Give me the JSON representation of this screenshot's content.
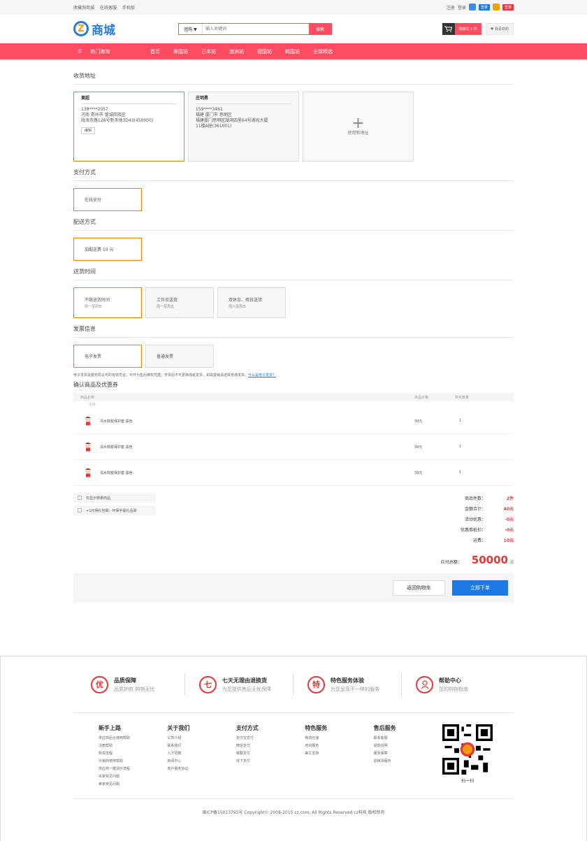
{
  "topbar": {
    "links": [
      "收藏淘商城",
      "在线客服",
      "手机版"
    ],
    "register": "注册",
    "login": "登录",
    "badge1": "登录",
    "badge2": "登录"
  },
  "header": {
    "logo_letter": "Z",
    "logo_text": "商城",
    "search_type": "团购 ▼",
    "search_placeholder": "输入关键词",
    "search_button": "搜索",
    "cart_label": "购物车 1 件",
    "fav_label": "♥ 我喜欢的"
  },
  "nav": {
    "category_label": "热门海淘",
    "items": [
      "首页",
      "美国站",
      "日本站",
      "澳洲站",
      "德国站",
      "韩国站",
      "全球精选"
    ]
  },
  "address": {
    "title": "收货地址",
    "cards": [
      {
        "name": "黄超",
        "phone": "139****2057",
        "line1": "河南 郑州市 管城回族区",
        "line2": "陇海东路126号新天地3D43(450000)",
        "line3": "",
        "edit": "编辑"
      },
      {
        "name": "庄明勇",
        "phone": "159****3461",
        "line1": "福建 厦门市 思明区",
        "line2": "福建厦门思明区湖滨四里64号湖光大厦",
        "line3": "11楼A座(361001)",
        "edit": ""
      }
    ],
    "add_label": "使用新地址"
  },
  "payment": {
    "title": "支付方式",
    "option": "在线支付"
  },
  "delivery": {
    "title": "配送方式",
    "option": "加配送费 10 元"
  },
  "delivery_time": {
    "title": "送货时间",
    "options": [
      {
        "label": "不限送货时间",
        "sub": "周一至周日"
      },
      {
        "label": "工作日送货",
        "sub": "周一至周五"
      },
      {
        "label": "双休日、假日送货",
        "sub": "周六至周日"
      }
    ]
  },
  "invoice": {
    "title": "发票信息",
    "options": [
      "电子发票",
      "普通发票"
    ],
    "note": "电子发票是税务局认可的有效凭证，可作为售后维权凭据，开票后不可更换成纸发票，如需报销请选择普通发票。",
    "note_link": "什么是电子发票？"
  },
  "confirm": {
    "title": "确认商品及优惠券",
    "col_name": "商品名称",
    "col_price": "单品价格",
    "col_qty": "购买数量",
    "subtotal_label": "小计",
    "items": [
      {
        "name": "渴水软胶保护套 黑色",
        "price": "39元",
        "qty": "1"
      },
      {
        "name": "渴水软胶保护套 黑色",
        "price": "39元",
        "qty": "1"
      },
      {
        "name": "渴水软胶保护套 黑色",
        "price": "39元",
        "qty": "1"
      }
    ],
    "check1": "仅显示特惠商品",
    "check2": "+1元得礼包袋：环保手提礼品袋"
  },
  "summary": {
    "rows": [
      {
        "k": "商品件数：",
        "v": "2件"
      },
      {
        "k": "金额合计：",
        "v": "40元"
      },
      {
        "k": "活动优惠：",
        "v": "-0元"
      },
      {
        "k": "优惠券抵扣：",
        "v": "-0元"
      },
      {
        "k": "运费：",
        "v": "10元"
      }
    ],
    "total_label": "应付总额：",
    "total_value": "50000",
    "total_unit": "元",
    "back_button": "返回购物车",
    "submit_button": "立即下单"
  },
  "footer": {
    "guarantees": [
      {
        "icon": "优",
        "title": "品质保障",
        "sub": "品质护航 购物无忧"
      },
      {
        "icon": "七",
        "title": "七天无理由退换货",
        "sub": "为您提供售后无忧保障"
      },
      {
        "icon": "特",
        "title": "特色服务体验",
        "sub": "为您呈现不一样的服务"
      },
      {
        "icon": "帮",
        "title": "帮助中心",
        "sub": "您的购物指南"
      }
    ],
    "columns": [
      {
        "title": "新手上路",
        "items": [
          "供应商后台使用帮助",
          "注册帮助",
          "购买流程",
          "分销商使用帮助",
          "供应商一键调价流程",
          "买家常见问题",
          "卖家常见问题"
        ]
      },
      {
        "title": "关于我们",
        "items": [
          "公司介绍",
          "联系我们",
          "人才招聘",
          "新闻中心",
          "商户服务协议"
        ]
      },
      {
        "title": "支付方式",
        "items": [
          "支付宝支付",
          "微信支付",
          "银联支付",
          "线下支付"
        ]
      },
      {
        "title": "特色服务",
        "items": [
          "物流仓储",
          "培训服务",
          "美工支持"
        ]
      },
      {
        "title": "售后服务",
        "items": [
          "联系客服",
          "退款说明",
          "服务保障",
          "退换货服务"
        ]
      }
    ],
    "qr_label": "扫一扫",
    "copyright": "闽ICP备15013795号 Copyright© 2008-2015 cz.com, All Rights Reserved cz科技 版权所有"
  },
  "colors": {
    "brand": "#ff4c61",
    "accent_border": "#f08300",
    "primary_button": "#1e78e4",
    "price_red": "#e4393c"
  }
}
